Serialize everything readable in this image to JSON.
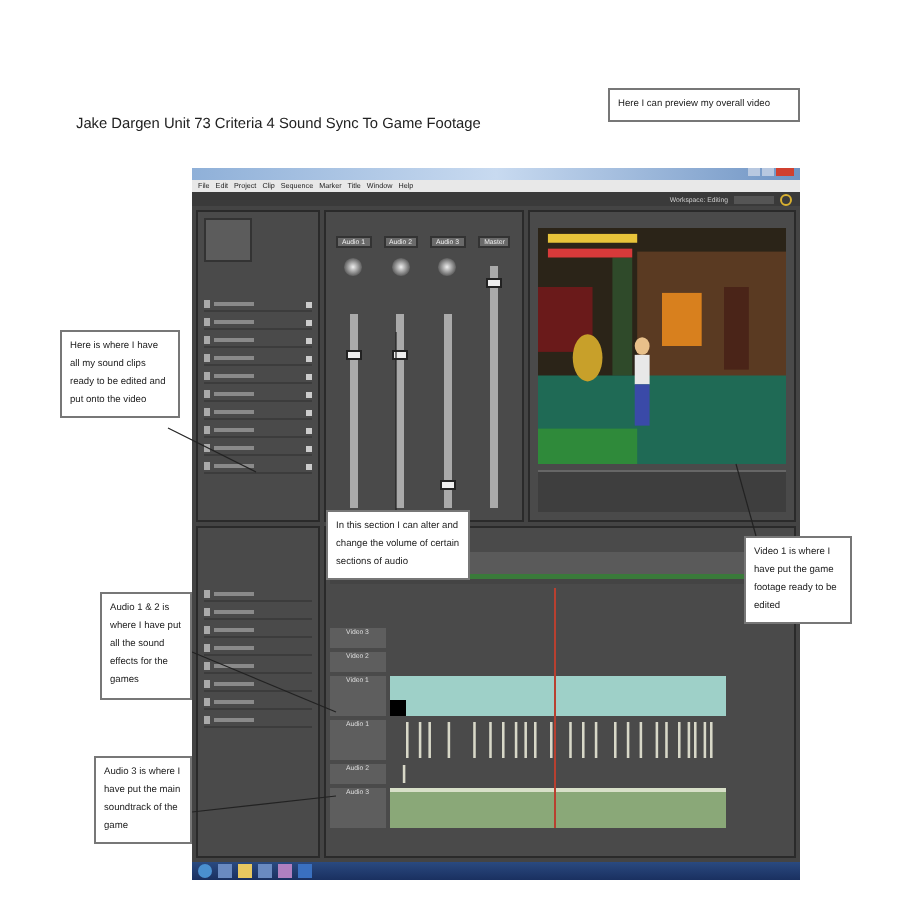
{
  "title": "Jake Dargen Unit 73 Criteria 4 Sound Sync To Game Footage",
  "callouts": [
    {
      "text": "Here I can preview my overall video"
    },
    {
      "text": "Here is where I have all my sound clips ready to be edited and put onto the video"
    },
    {
      "text": "In this section I can alter and change the volume of certain sections of audio"
    },
    {
      "text": "Video 1 is where I have put the game footage ready to be edited"
    },
    {
      "text": "Audio 1 & 2 is where I have put all the sound effects for the games"
    },
    {
      "text": "Audio 3 is where I have put the main soundtrack of the game"
    }
  ],
  "app": {
    "menu": [
      "File",
      "Edit",
      "Project",
      "Clip",
      "Sequence",
      "Marker",
      "Title",
      "Window",
      "Help"
    ],
    "workspace": "Workspace: Editing",
    "mixer": [
      {
        "name": "Audio 1",
        "level": 0.8
      },
      {
        "name": "Audio 2",
        "level": 0.8
      },
      {
        "name": "Audio 3",
        "level": 0.1
      },
      {
        "name": "Master",
        "level": 0.95
      }
    ],
    "tracks": [
      {
        "name": "Video 3",
        "kind": "empty"
      },
      {
        "name": "Video 2",
        "kind": "empty"
      },
      {
        "name": "Video 1",
        "kind": "video"
      },
      {
        "name": "Audio 1",
        "kind": "sfx"
      },
      {
        "name": "Audio 2",
        "kind": "sfx_single"
      },
      {
        "name": "Audio 3",
        "kind": "music"
      }
    ]
  }
}
